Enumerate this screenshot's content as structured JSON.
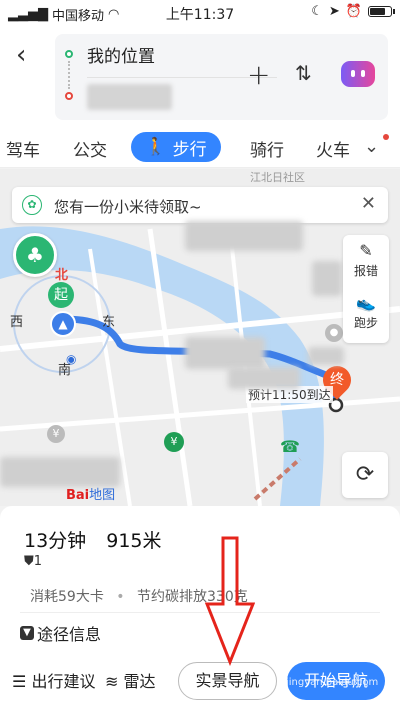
{
  "status": {
    "carrier": "中国移动",
    "time": "上午11:37"
  },
  "header": {
    "from": "我的位置",
    "add": "+",
    "swap": "⇅"
  },
  "tabs": [
    "驾车",
    "公交",
    "步行",
    "骑行",
    "火车"
  ],
  "active_tab": "步行",
  "map": {
    "notice": "您有一份小米待领取~",
    "side_buttons": [
      {
        "label": "报错",
        "icon": "edit-icon"
      },
      {
        "label": "跑步",
        "icon": "shoe-icon"
      }
    ],
    "compass": {
      "north": "北",
      "start": "起",
      "west": "西",
      "east": "东",
      "south": "南"
    },
    "end": "终",
    "eta": "预计11:50到达",
    "map_text": "江北日社区",
    "logo_main": "Bai",
    "logo_sub": "地图"
  },
  "summary": {
    "duration": "13分钟",
    "distance": "915米",
    "lights": "1",
    "calories": "消耗59大卡",
    "carbon": "节约碳排放330克",
    "path_info": "途径信息"
  },
  "actions": {
    "advice": "出行建议",
    "radar": "雷达",
    "ar_nav": "实景导航",
    "start_nav": "开始导航"
  },
  "watermark": "jingyan.baidu.com",
  "colors": {
    "accent": "#3385ff",
    "start": "#2bb673",
    "end": "#f25a2a",
    "route": "#3d7ee8"
  }
}
